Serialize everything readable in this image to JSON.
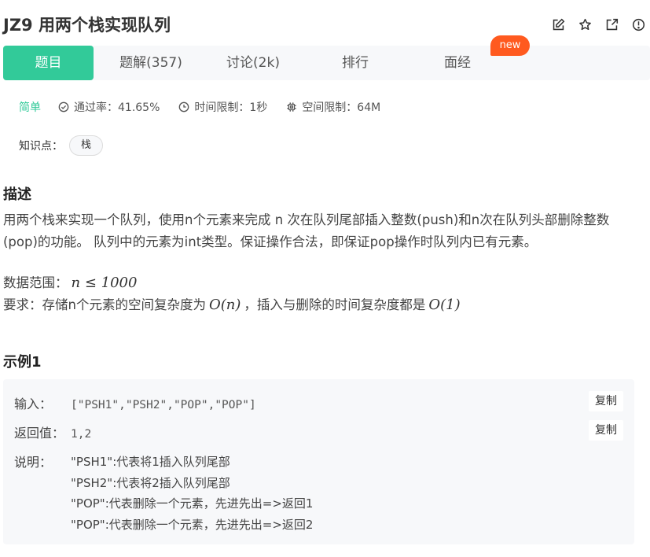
{
  "header": {
    "title": "JZ9  用两个栈实现队列",
    "icons": [
      "edit-icon",
      "star-icon",
      "external-link-icon",
      "info-icon"
    ]
  },
  "tabs": [
    {
      "label": "题目",
      "active": true
    },
    {
      "label": "题解(357)",
      "active": false
    },
    {
      "label": "讨论(2k)",
      "active": false
    },
    {
      "label": "排行",
      "active": false
    },
    {
      "label": "面经",
      "active": false
    }
  ],
  "new_badge": "new",
  "meta": {
    "difficulty": "简单",
    "pass_rate": "通过率：41.65%",
    "time_limit": "时间限制：1秒",
    "space_limit": "空间限制：64M"
  },
  "knowledge": {
    "label": "知识点：",
    "tags": [
      "栈"
    ]
  },
  "description": {
    "title": "描述",
    "text": "用两个栈来实现一个队列，使用n个元素来完成 n 次在队列尾部插入整数(push)和n次在队列头部删除整数(pop)的功能。 队列中的元素为int类型。保证操作合法，即保证pop操作时队列内已有元素。",
    "range_prefix": "数据范围：",
    "range_math": "n ≤ 1000",
    "req_prefix": "要求：存储n个元素的空间复杂度为",
    "req_math1": "O(n)",
    "req_mid": "，插入与删除的时间复杂度都是",
    "req_math2": "O(1)"
  },
  "example": {
    "title": "示例1",
    "input_label": "输入：",
    "input_value": "[\"PSH1\",\"PSH2\",\"POP\",\"POP\"]",
    "output_label": "返回值：",
    "output_value": "1,2",
    "copy_label": "复制",
    "explain_label": "说明：",
    "explain_lines": [
      "\"PSH1\":代表将1插入队列尾部",
      "\"PSH2\":代表将2插入队列尾部",
      "\"POP\":代表删除一个元素，先进先出=>返回1",
      "\"POP\":代表删除一个元素，先进先出=>返回2"
    ]
  },
  "colors": {
    "accent": "#32ca99",
    "badge": "#ff5a1f",
    "panel_bg": "#f7f8fa"
  }
}
